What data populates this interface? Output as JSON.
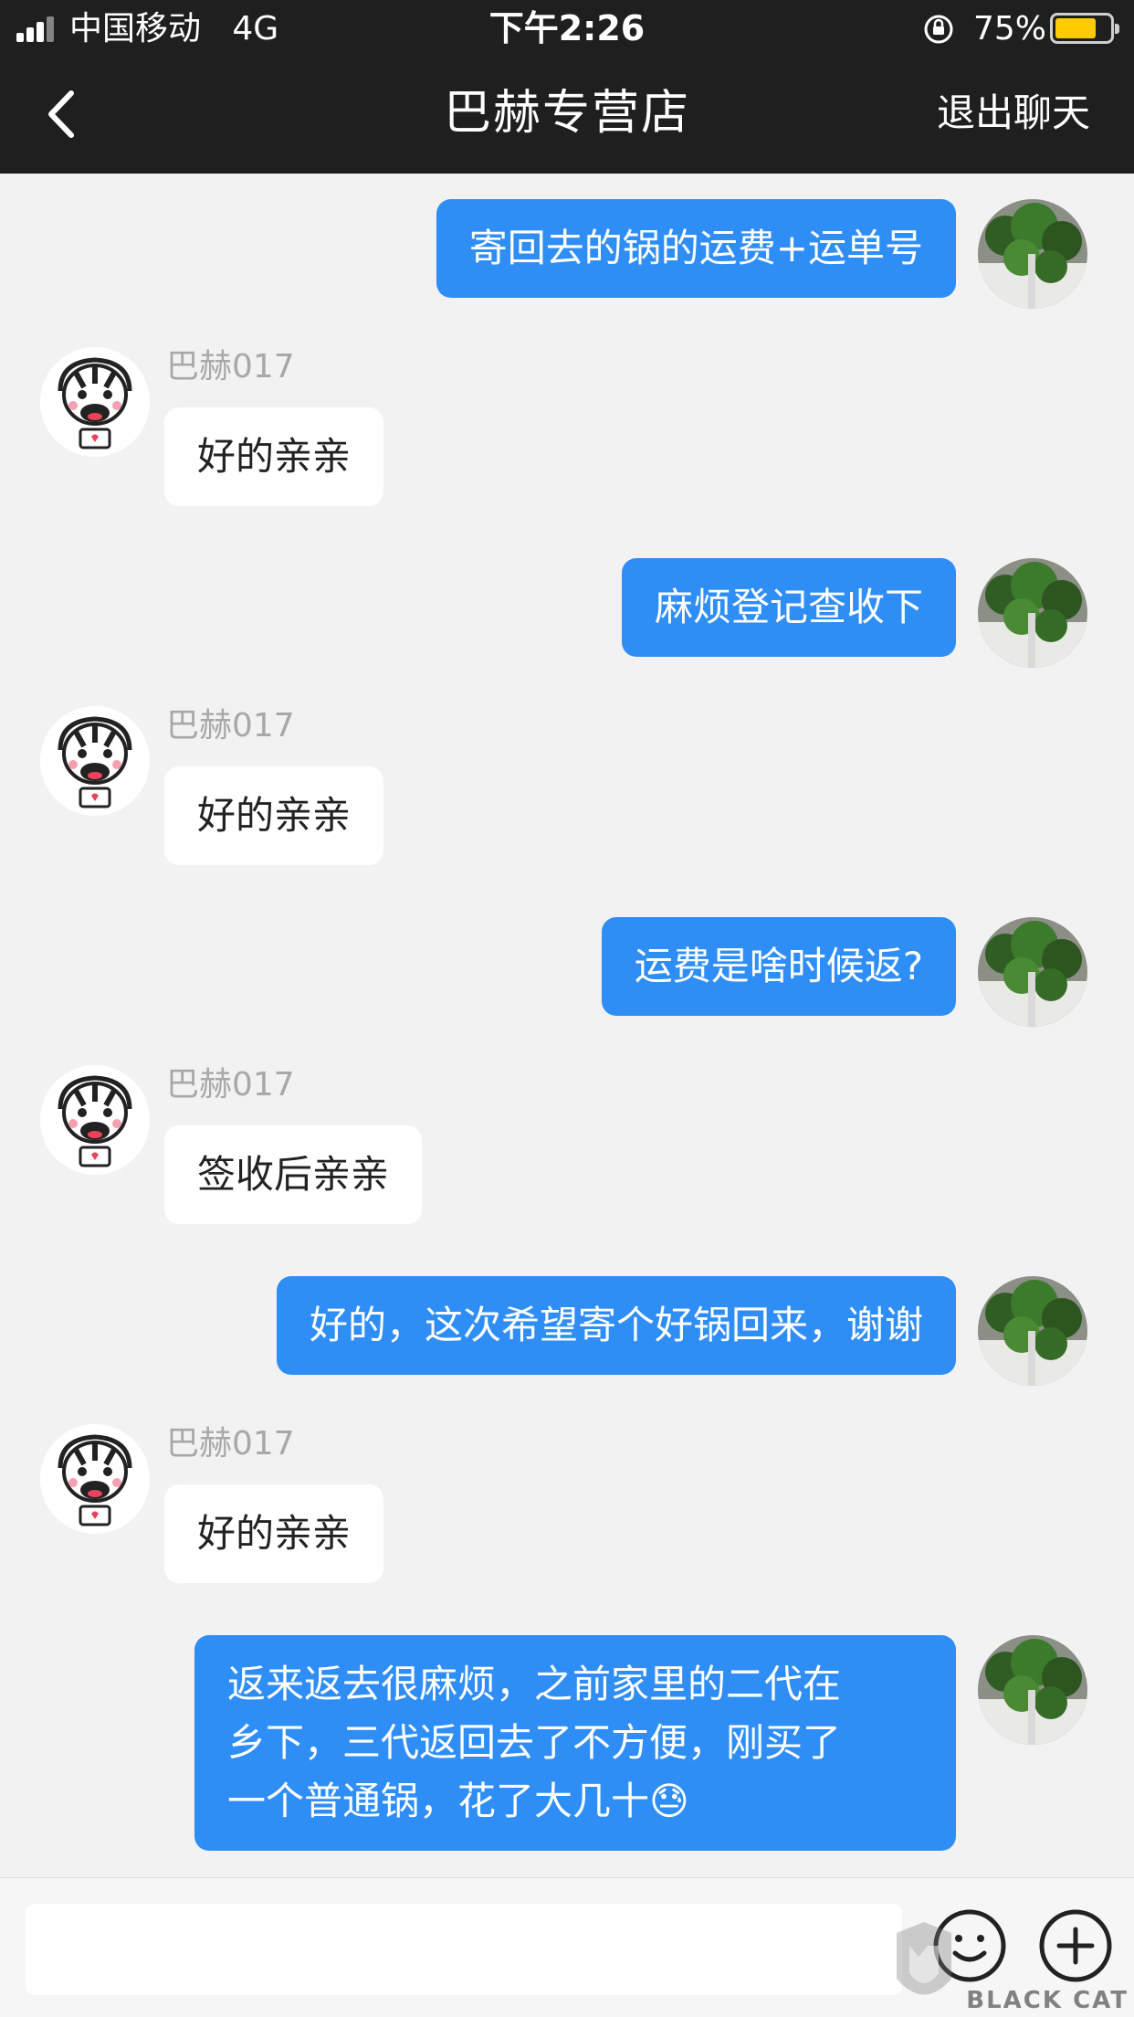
{
  "status_bar": {
    "carrier": "中国移动",
    "network": "4G",
    "time": "下午2:26",
    "battery_percent": "75%",
    "battery_level": 0.75
  },
  "nav": {
    "title": "巴赫专营店",
    "exit_label": "退出聊天",
    "back_icon": "chevron-left-icon"
  },
  "messages": [
    {
      "from": "me",
      "text": "寄回去的锅的运费+运单号"
    },
    {
      "from": "shop",
      "sender": "巴赫017",
      "text": "好的亲亲"
    },
    {
      "from": "me",
      "text": "麻烦登记查收下"
    },
    {
      "from": "shop",
      "sender": "巴赫017",
      "text": "好的亲亲"
    },
    {
      "from": "me",
      "text": "运费是啥时候返?"
    },
    {
      "from": "shop",
      "sender": "巴赫017",
      "text": "签收后亲亲"
    },
    {
      "from": "me",
      "text": "好的，这次希望寄个好锅回来，谢谢"
    },
    {
      "from": "shop",
      "sender": "巴赫017",
      "text": "好的亲亲"
    },
    {
      "from": "me",
      "lines": [
        "返来返去很麻烦，之前家里的二代在",
        "乡下，三代返回去了不方便，刚买了",
        "一个普通锅，花了大几十"
      ],
      "emoji": "😓"
    }
  ],
  "input": {
    "placeholder": ""
  },
  "icons": {
    "emoji_button": "smiley-icon",
    "add_button": "plus-circle-icon",
    "watermark": "black-cat-logo"
  },
  "watermark_text": "BLACK CAT",
  "colors": {
    "nav_bg": "#1f1f1f",
    "my_bubble": "#2f8ef5",
    "shop_bubble": "#ffffff",
    "chat_bg": "#f2f2f2",
    "battery": "#ffcc00"
  }
}
